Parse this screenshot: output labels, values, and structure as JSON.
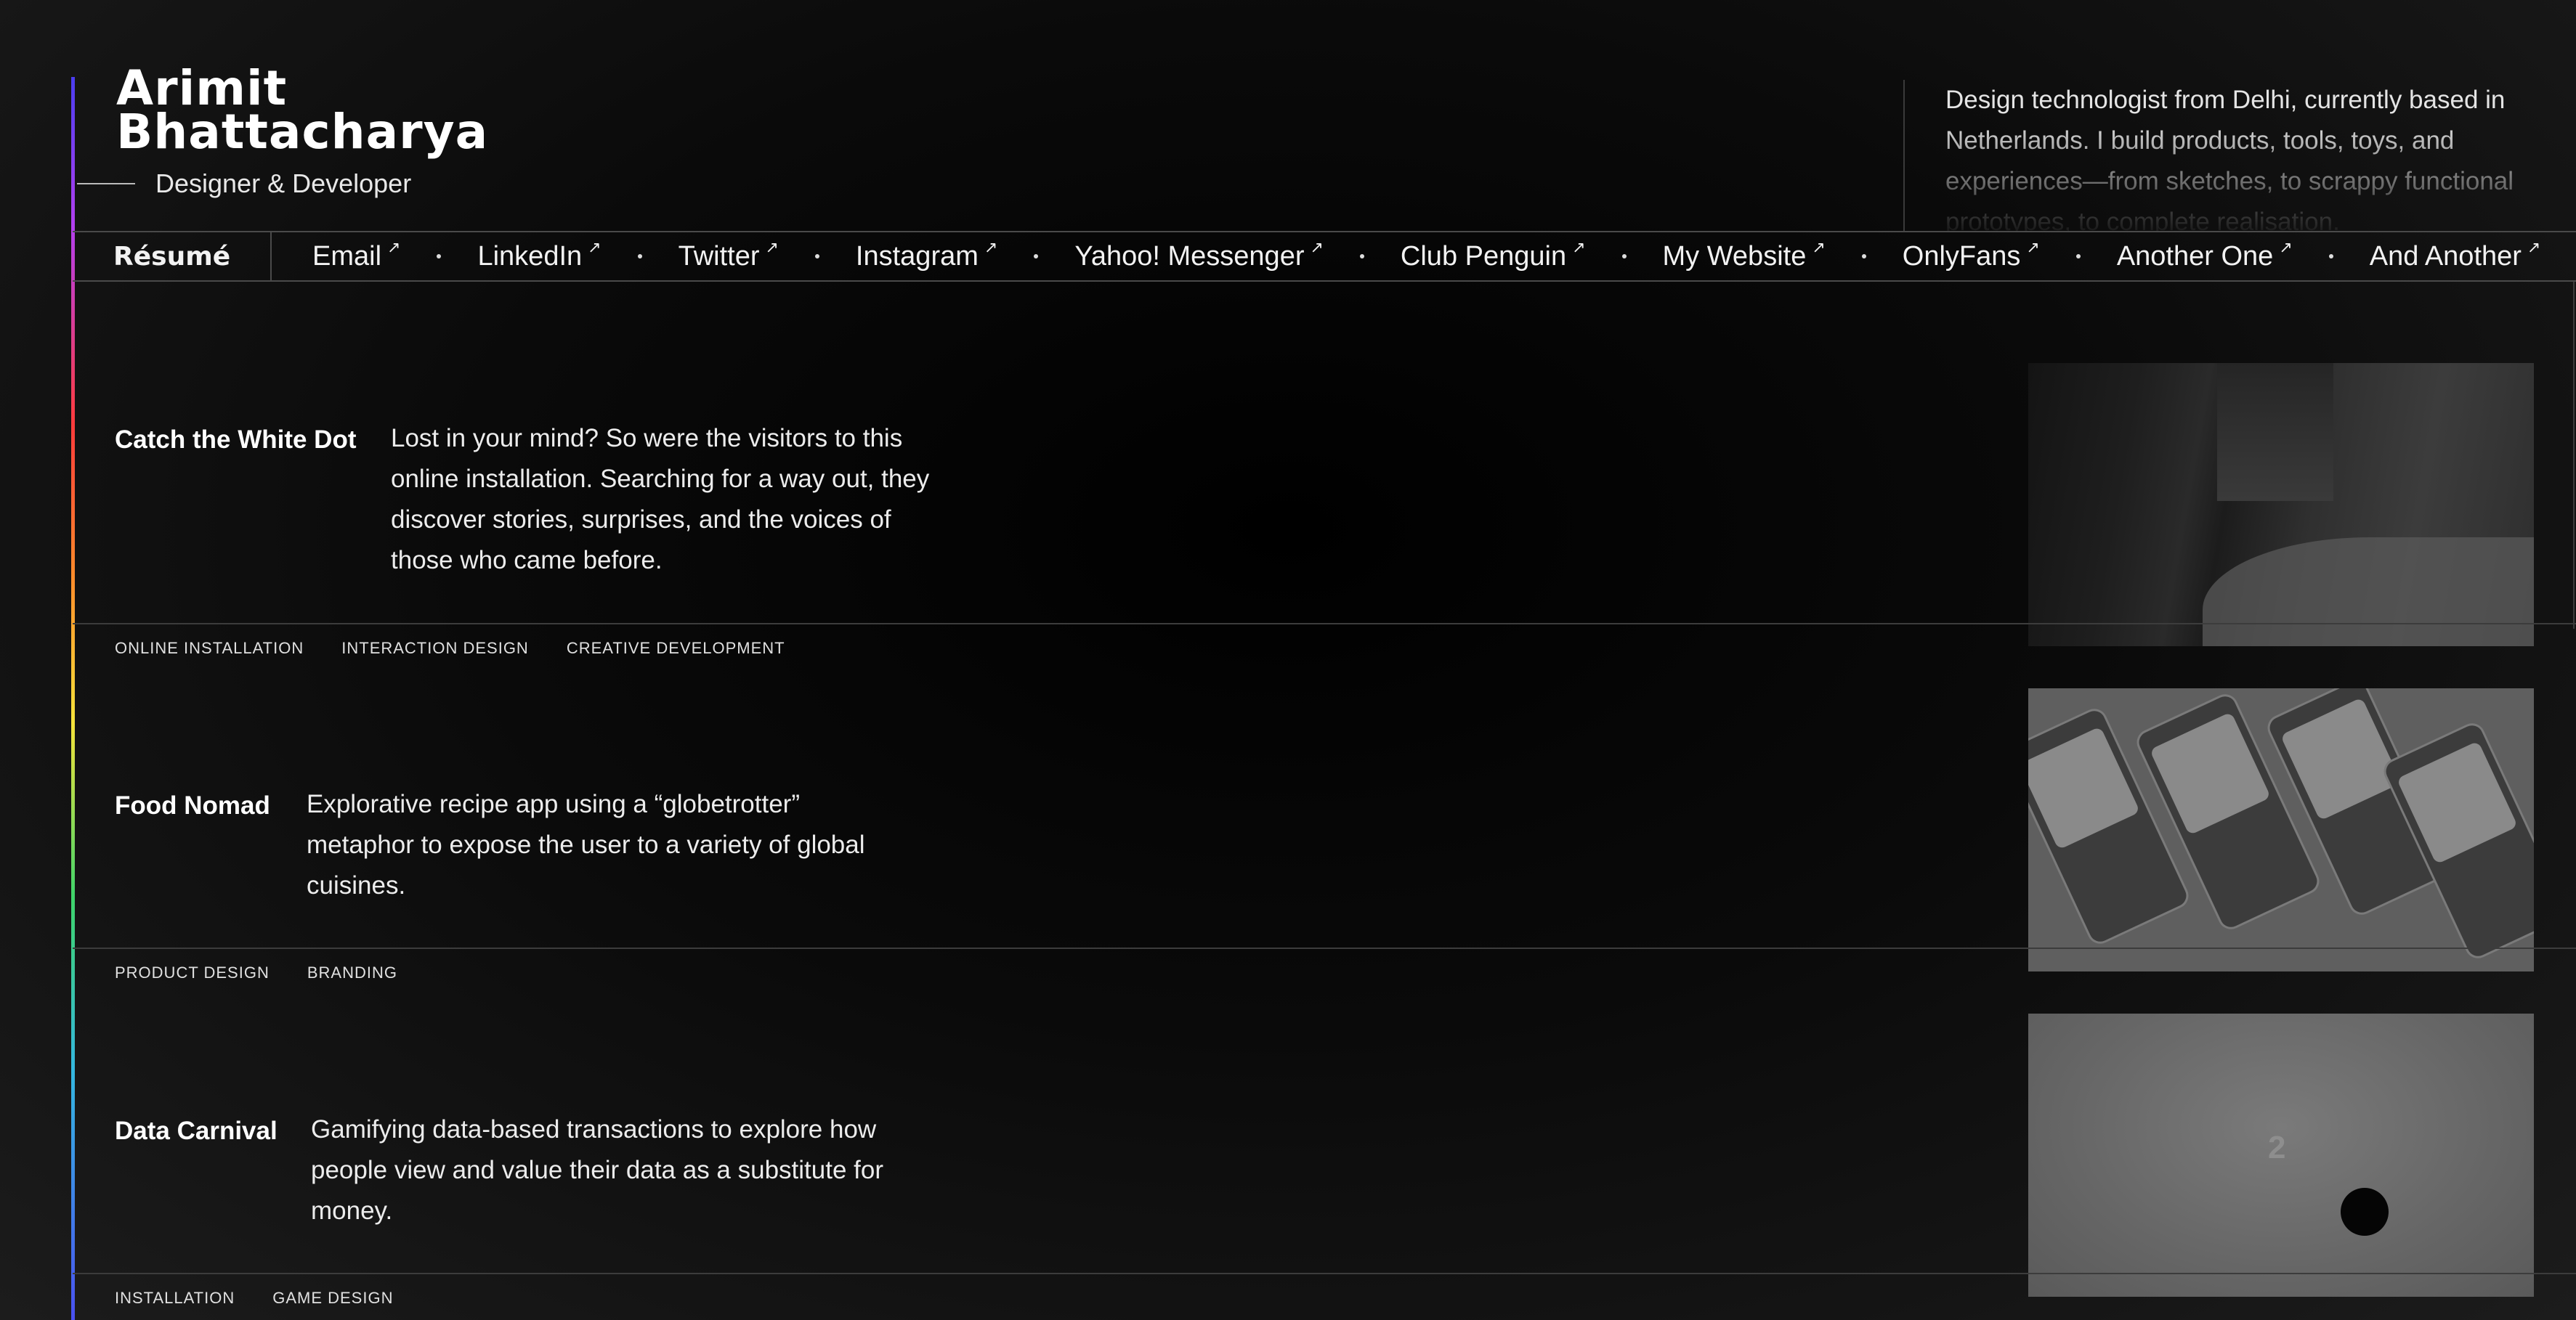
{
  "header": {
    "name_line1": "Arimit",
    "name_line2": "Bhattacharya",
    "role": "Designer & Developer",
    "bio": "Design technologist from Delhi, currently based in Netherlands. I build products, tools, toys, and experiences—from sketches, to scrappy functional prototypes, to complete realisation."
  },
  "nav": {
    "resume_label": "Résumé",
    "links": [
      "Email",
      "LinkedIn",
      "Twitter",
      "Instagram",
      "Yahoo! Messenger",
      "Club Penguin",
      "My Website",
      "OnlyFans",
      "Another One",
      "And Another"
    ],
    "arrow_glyph": "↗"
  },
  "projects": [
    {
      "title": "Catch the White Dot",
      "description": "Lost in your mind? So were the visitors to this online installation. Searching for a way out, they discover stories, surprises, and the voices of those who came before.",
      "tags": [
        "ONLINE INSTALLATION",
        "INTERACTION DESIGN",
        "CREATIVE DEVELOPMENT"
      ]
    },
    {
      "title": "Food Nomad",
      "description": "Explorative recipe app using a “globetrotter” metaphor to expose the user to a variety of global cuisines.",
      "tags": [
        "PRODUCT DESIGN",
        "BRANDING"
      ]
    },
    {
      "title": "Data Carnival",
      "description": "Gamifying data-based transactions to explore how people view and value their data as a substitute for money.",
      "tags": [
        "INSTALLATION",
        "GAME DESIGN"
      ],
      "thumb_number": "2"
    }
  ],
  "colors": {
    "background": "#000000",
    "text": "#ffffff",
    "divider": "#3c3c3c"
  }
}
